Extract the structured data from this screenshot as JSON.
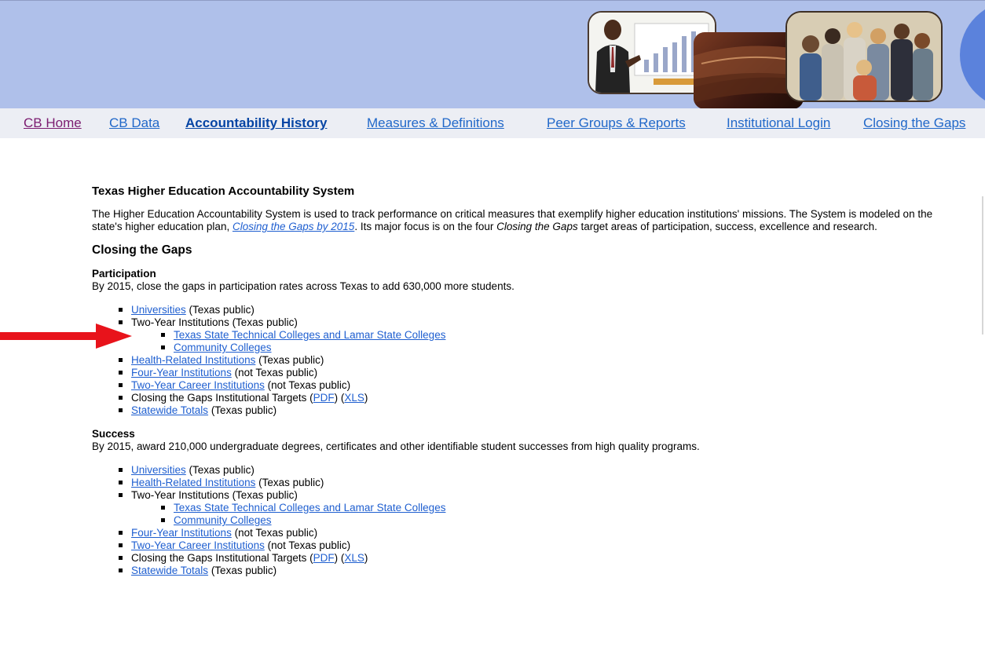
{
  "nav": {
    "items": [
      {
        "label": "CB Home",
        "state": "visited"
      },
      {
        "label": "CB Data",
        "state": "normal"
      },
      {
        "label": "Accountability History",
        "state": "active"
      },
      {
        "label": "Measures & Definitions",
        "state": "normal"
      },
      {
        "label": "Peer Groups & Reports",
        "state": "normal"
      },
      {
        "label": "Institutional Login",
        "state": "normal"
      },
      {
        "label": "Closing the Gaps",
        "state": "normal"
      }
    ]
  },
  "page": {
    "title": "Texas Higher Education Accountability System",
    "intro_1": "The Higher Education Accountability System is used to track performance on critical measures that exemplify higher education institutions' missions. The System is modeled on the state's higher education plan, ",
    "intro_link": "Closing the Gaps by 2015",
    "intro_2": ". Its major focus is on the four ",
    "intro_em": "Closing the Gaps",
    "intro_3": " target areas of participation, success, excellence and research.",
    "subtitle": "Closing the Gaps"
  },
  "participation": {
    "heading": "Participation",
    "desc": "By 2015, close the gaps in participation rates across Texas to add 630,000 more students.",
    "universities": {
      "link": "Universities",
      "note": " (Texas public)"
    },
    "two_year": "Two-Year Institutions (Texas public)",
    "tstc": "Texas State Technical Colleges and Lamar State Colleges",
    "community": "Community Colleges",
    "health": {
      "link": "Health-Related Institutions",
      "note": " (Texas public)"
    },
    "four_year": {
      "link": "Four-Year Institutions",
      "note": " (not Texas public)"
    },
    "career": {
      "link": "Two-Year Career Institutions",
      "note": " (not Texas public)"
    },
    "targets": {
      "text": "Closing the Gaps Institutional Targets  (",
      "pdf": "PDF",
      "mid": ") (",
      "xls": "XLS",
      "end": ")"
    },
    "statewide": {
      "link": "Statewide Totals",
      "note": " (Texas public)"
    }
  },
  "success": {
    "heading": "Success",
    "desc": "By 2015, award 210,000 undergraduate degrees, certificates and other identifiable student successes from high quality programs.",
    "universities": {
      "link": "Universities",
      "note": " (Texas public)"
    },
    "health": {
      "link": "Health-Related Institutions",
      "note": " (Texas public)"
    },
    "two_year": "Two-Year Institutions (Texas public)",
    "tstc": "Texas State Technical Colleges and Lamar State Colleges",
    "community": "Community Colleges",
    "four_year": {
      "link": "Four-Year Institutions",
      "note": " (not Texas public)"
    },
    "career": {
      "link": "Two-Year Career Institutions",
      "note": " (not Texas public)"
    },
    "targets": {
      "text": "Closing the Gaps Institutional Targets  (",
      "pdf": "PDF",
      "mid": ") (",
      "xls": "XLS",
      "end": ")"
    },
    "statewide": {
      "link": "Statewide Totals",
      "note": " (Texas public)"
    }
  },
  "colors": {
    "banner": "#afc0ea",
    "link": "#1f5fd0",
    "visited": "#7b1c70",
    "active": "#0645a4",
    "arrow": "#e8131b"
  },
  "icons": {
    "annotation": "red-arrow-icon"
  }
}
